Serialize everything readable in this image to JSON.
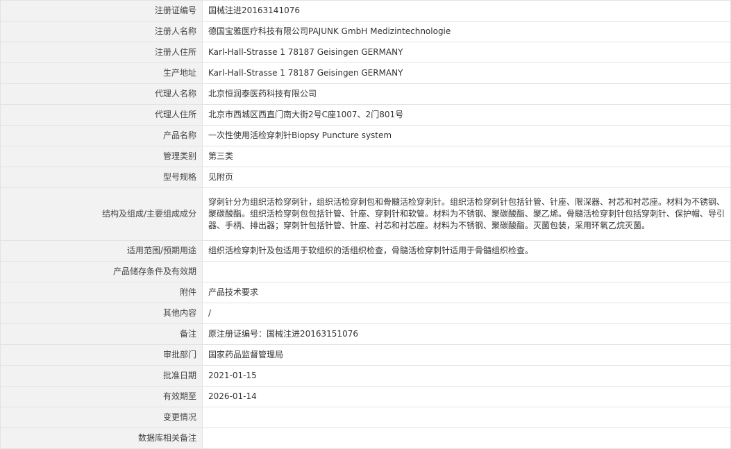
{
  "rows": [
    {
      "label": "注册证编号",
      "value": "国械注进20163141076"
    },
    {
      "label": "注册人名称",
      "value": "德国宝雅医疗科技有限公司PAJUNK GmbH Medizintechnologie"
    },
    {
      "label": "注册人住所",
      "value": "Karl-Hall-Strasse 1 78187 Geisingen GERMANY"
    },
    {
      "label": "生产地址",
      "value": "Karl-Hall-Strasse 1 78187 Geisingen GERMANY"
    },
    {
      "label": "代理人名称",
      "value": "北京恒润泰医药科技有限公司"
    },
    {
      "label": "代理人住所",
      "value": "北京市西城区西直门南大街2号C座1007、2门801号"
    },
    {
      "label": "产品名称",
      "value": "一次性使用活检穿刺针Biopsy Puncture system"
    },
    {
      "label": "管理类别",
      "value": "第三类"
    },
    {
      "label": "型号规格",
      "value": "见附页"
    },
    {
      "label": "结构及组成/主要组成成分",
      "value": "穿刺针分为组织活检穿刺针，组织活检穿刺包和骨髓活检穿刺针。组织活检穿刺针包括针管、针座、限深器、衬芯和衬芯座。材料为不锈钢、聚碳酸酯。组织活检穿刺包包括针管、针座、穿刺针和软管。材料为不锈钢、聚碳酸酯、聚乙烯。骨髓活检穿刺针包括穿刺针、保护帽、导引器、手柄、排出器；穿刺针包括针管、针座、衬芯和衬芯座。材料为不锈钢、聚碳酸酯。灭菌包装，采用环氧乙烷灭菌。"
    },
    {
      "label": "适用范围/预期用途",
      "value": "组织活检穿刺针及包适用于软组织的活组织检查，骨髓活检穿刺针适用于骨髓组织检查。"
    },
    {
      "label": "产品储存条件及有效期",
      "value": ""
    },
    {
      "label": "附件",
      "value": "产品技术要求"
    },
    {
      "label": "其他内容",
      "value": "/"
    },
    {
      "label": "备注",
      "value": "原注册证编号：国械注进20163151076"
    },
    {
      "label": "审批部门",
      "value": "国家药品监督管理局"
    },
    {
      "label": "批准日期",
      "value": "2021-01-15"
    },
    {
      "label": "有效期至",
      "value": "2026-01-14"
    },
    {
      "label": "变更情况",
      "value": ""
    },
    {
      "label": "数据库相关备注",
      "value": ""
    }
  ]
}
